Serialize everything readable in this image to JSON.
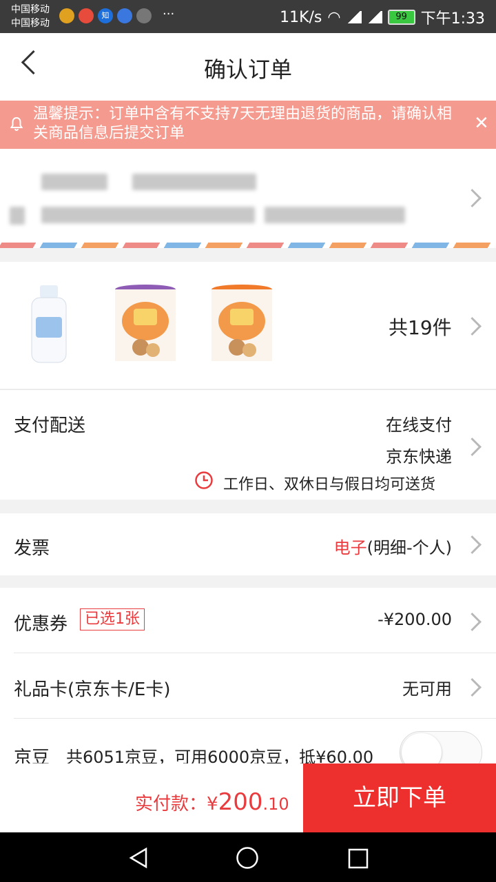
{
  "status": {
    "carrier1": "中国移动",
    "carrier2": "中国移动",
    "speed": "11K/s",
    "battery": "99",
    "time": "下午1:33",
    "more": "···"
  },
  "nav": {
    "title": "确认订单"
  },
  "notice": {
    "text": "温馨提示：订单中含有不支持7天无理由退货的商品，请确认相关商品信息后提交订单",
    "close": "✕"
  },
  "products": {
    "count_label": "共19件"
  },
  "shipping": {
    "label": "支付配送",
    "payment": "在线支付",
    "express": "京东快递",
    "delivery_note": "工作日、双休日与假日均可送货"
  },
  "invoice": {
    "label": "发票",
    "type_highlight": "电子",
    "type_rest": "(明细-个人)"
  },
  "coupon": {
    "label": "优惠券",
    "tag": "已选1张",
    "value": "-¥200.00"
  },
  "giftcard": {
    "label": "礼品卡(京东卡/E卡)",
    "value": "无可用"
  },
  "jingdou": {
    "label": "京豆",
    "desc": "共6051京豆，可用6000京豆，抵¥60.00"
  },
  "bottom": {
    "pay_label": "实付款：",
    "currency": "¥",
    "amount_int": "200",
    "amount_dec": ".10",
    "submit": "立即下单"
  },
  "colors": {
    "accent": "#ed2f2e",
    "notice_bg": "#f59a8e"
  }
}
